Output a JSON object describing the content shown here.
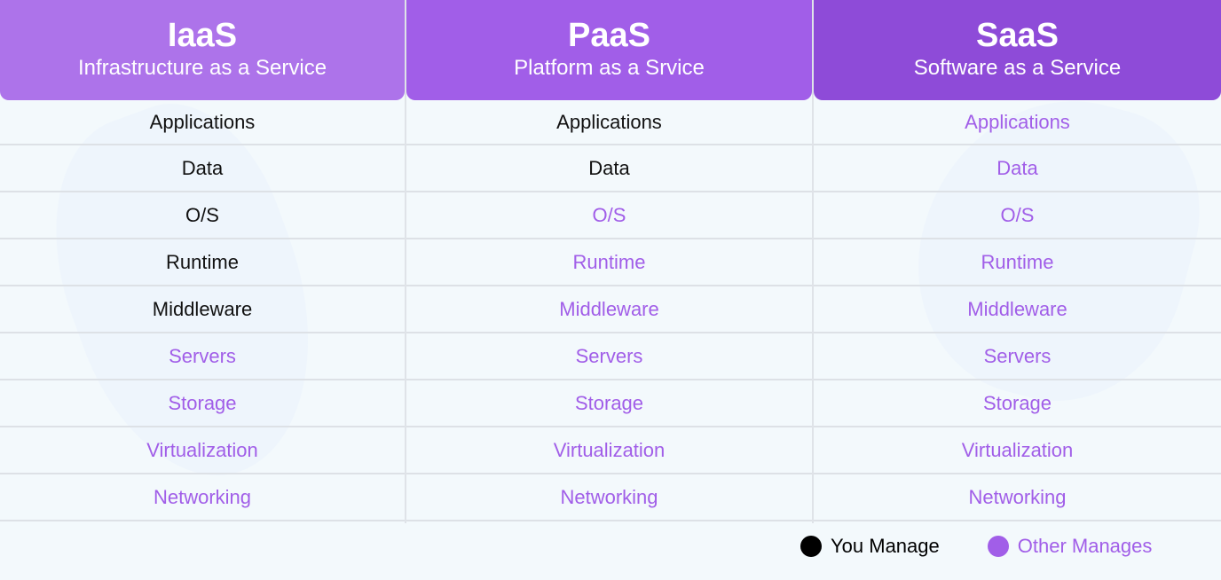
{
  "columns": [
    {
      "title": "IaaS",
      "subtitle": "Infrastructure as a Service",
      "header_color": "#ad73ea",
      "rows": [
        {
          "label": "Applications",
          "managed_by": "you"
        },
        {
          "label": "Data",
          "managed_by": "you"
        },
        {
          "label": "O/S",
          "managed_by": "you"
        },
        {
          "label": "Runtime",
          "managed_by": "you"
        },
        {
          "label": "Middleware",
          "managed_by": "you"
        },
        {
          "label": "Servers",
          "managed_by": "other"
        },
        {
          "label": "Storage",
          "managed_by": "other"
        },
        {
          "label": "Virtualization",
          "managed_by": "other"
        },
        {
          "label": "Networking",
          "managed_by": "other"
        }
      ]
    },
    {
      "title": "PaaS",
      "subtitle": "Platform as a Srvice",
      "header_color": "#a15ee8",
      "rows": [
        {
          "label": "Applications",
          "managed_by": "you"
        },
        {
          "label": "Data",
          "managed_by": "you"
        },
        {
          "label": "O/S",
          "managed_by": "other"
        },
        {
          "label": "Runtime",
          "managed_by": "other"
        },
        {
          "label": "Middleware",
          "managed_by": "other"
        },
        {
          "label": "Servers",
          "managed_by": "other"
        },
        {
          "label": "Storage",
          "managed_by": "other"
        },
        {
          "label": "Virtualization",
          "managed_by": "other"
        },
        {
          "label": "Networking",
          "managed_by": "other"
        }
      ]
    },
    {
      "title": "SaaS",
      "subtitle": "Software as a Service",
      "header_color": "#8e4bd8",
      "rows": [
        {
          "label": "Applications",
          "managed_by": "other"
        },
        {
          "label": "Data",
          "managed_by": "other"
        },
        {
          "label": "O/S",
          "managed_by": "other"
        },
        {
          "label": "Runtime",
          "managed_by": "other"
        },
        {
          "label": "Middleware",
          "managed_by": "other"
        },
        {
          "label": "Servers",
          "managed_by": "other"
        },
        {
          "label": "Storage",
          "managed_by": "other"
        },
        {
          "label": "Virtualization",
          "managed_by": "other"
        },
        {
          "label": "Networking",
          "managed_by": "other"
        }
      ]
    }
  ],
  "legend": {
    "you": {
      "label": "You Manage",
      "color": "#000000"
    },
    "other": {
      "label": "Other Manages",
      "color": "#a15ee8"
    }
  }
}
